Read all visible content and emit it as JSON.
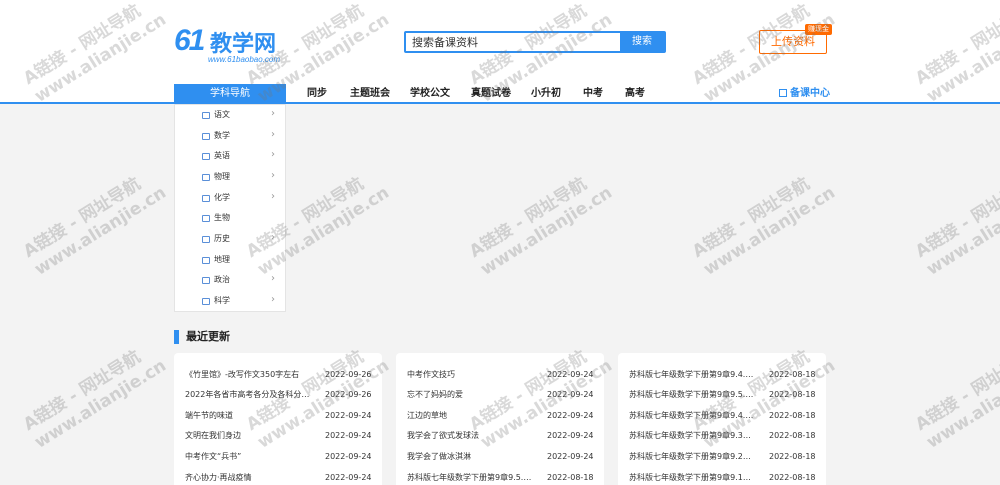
{
  "logo": {
    "number": "61",
    "name": "教学网",
    "domain": "www.61baobao.com"
  },
  "search": {
    "placeholder": "搜索备课资料",
    "button_label": "搜索"
  },
  "upload": {
    "label": "上传资料",
    "badge": "赚现金"
  },
  "nav": {
    "subject_label": "学科导航",
    "items": [
      "同步",
      "主题班会",
      "学校公文",
      "真题试卷",
      "小升初",
      "中考",
      "高考"
    ],
    "center_label": "备课中心"
  },
  "subjects": [
    "语文",
    "数学",
    "英语",
    "物理",
    "化学",
    "生物",
    "历史",
    "地理",
    "政治",
    "科学"
  ],
  "recent": {
    "title": "最近更新",
    "columns": [
      [
        {
          "title": "《竹里馆》-改写作文350字左右",
          "date": "2022-09-26"
        },
        {
          "title": "2022年各省市高考各分及各科分数...",
          "date": "2022-09-26"
        },
        {
          "title": "端午节的味道",
          "date": "2022-09-24"
        },
        {
          "title": "文明在我们身边",
          "date": "2022-09-24"
        },
        {
          "title": "中考作文“兵书”",
          "date": "2022-09-24"
        },
        {
          "title": "齐心协力·再战疫情",
          "date": "2022-09-24"
        }
      ],
      [
        {
          "title": "中考作文技巧",
          "date": "2022-09-24"
        },
        {
          "title": "忘不了妈妈的爱",
          "date": "2022-09-24"
        },
        {
          "title": "江边的草地",
          "date": "2022-09-24"
        },
        {
          "title": "我学会了欲式发球法",
          "date": "2022-09-24"
        },
        {
          "title": "我学会了做冰淇淋",
          "date": "2022-09-24"
        },
        {
          "title": "苏科版七年级数学下册第9章9.5.2运...",
          "date": "2022-08-18"
        }
      ],
      [
        {
          "title": "苏科版七年级数学下册第9章9.4.1完...",
          "date": "2022-08-18"
        },
        {
          "title": "苏科版七年级数学下册第9章9.5.1提...",
          "date": "2022-08-18"
        },
        {
          "title": "苏科版七年级数学下册第9章9.4.2乘...",
          "date": "2022-08-18"
        },
        {
          "title": "苏科版七年级数学下册第9章9.3多项...",
          "date": "2022-08-18"
        },
        {
          "title": "苏科版七年级数学下册第9章9.2单项...",
          "date": "2022-08-18"
        },
        {
          "title": "苏科版七年级数学下册第9章9.1单项...",
          "date": "2022-08-18"
        }
      ]
    ]
  },
  "watermark": {
    "line1": "A链接 - 网址导航",
    "line2": "www.alianjie.cn"
  },
  "colors": {
    "accent": "#2f8ff0",
    "upload": "#ff6a00",
    "background": "#f3f3f3"
  }
}
